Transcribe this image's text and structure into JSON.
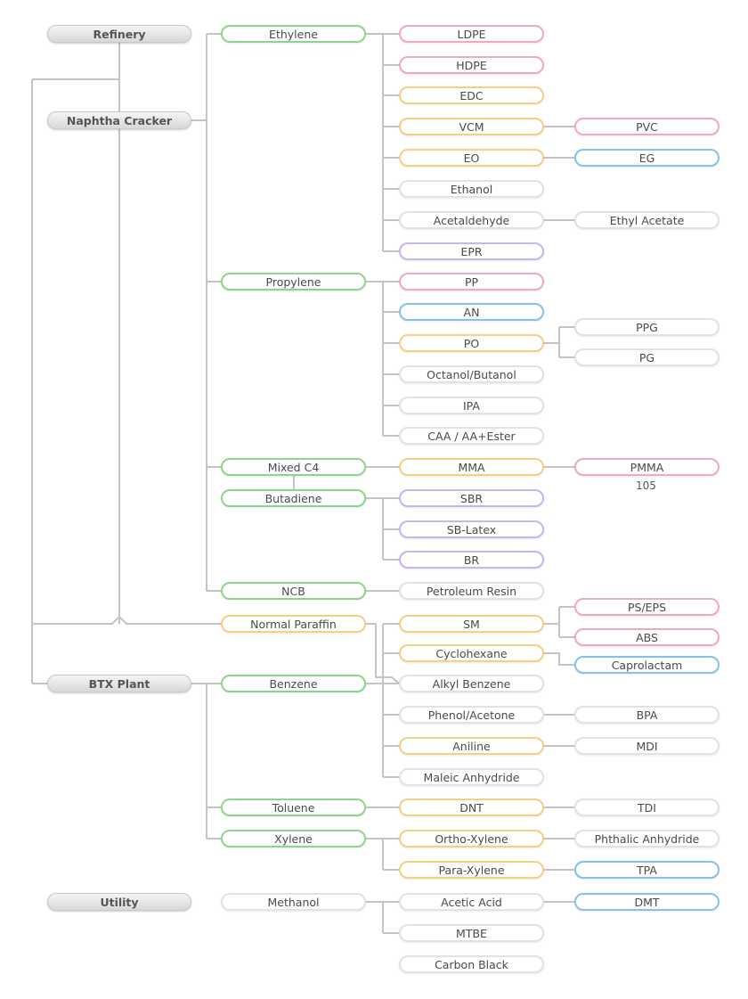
{
  "diagram": {
    "type": "petrochemical product tree",
    "colors": {
      "source": "#d8d8d8",
      "green": "#8fd48a",
      "orange": "#f5cf82",
      "pink": "#f2a9bf",
      "blue": "#86c2e6",
      "purple": "#c9b4ee",
      "gray": "#e2e2e2",
      "connector": "#c4c4c4"
    },
    "sources": {
      "refinery": "Refinery",
      "naphtha_cracker": "Naphtha Cracker",
      "btx_plant": "BTX Plant",
      "utility": "Utility"
    },
    "basics": {
      "ethylene": "Ethylene",
      "propylene": "Propylene",
      "mixed_c4": "Mixed C4",
      "butadiene": "Butadiene",
      "ncb": "NCB",
      "normal_paraffin": "Normal Paraffin",
      "benzene": "Benzene",
      "toluene": "Toluene",
      "xylene": "Xylene",
      "methanol": "Methanol"
    },
    "intermediates": {
      "ldpe": "LDPE",
      "hdpe": "HDPE",
      "edc": "EDC",
      "vcm": "VCM",
      "eo": "EO",
      "ethanol": "Ethanol",
      "acetaldehyde": "Acetaldehyde",
      "epr": "EPR",
      "pp": "PP",
      "an": "AN",
      "po": "PO",
      "octanol_butanol": "Octanol/Butanol",
      "ipa": "IPA",
      "caa": "CAA  / AA+Ester",
      "mma": "MMA",
      "sbr": "SBR",
      "sb_latex": "SB-Latex",
      "br": "BR",
      "petroleum_resin": "Petroleum Resin",
      "sm": "SM",
      "cyclohexane": "Cyclohexane",
      "alkyl_benzene": "Alkyl Benzene",
      "phenol_acetone": "Phenol/Acetone",
      "aniline": "Aniline",
      "maleic_anhydride": "Maleic Anhydride",
      "dnt": "DNT",
      "ortho_xylene": "Ortho-Xylene",
      "para_xylene": "Para-Xylene",
      "acetic_acid": "Acetic Acid",
      "mtbe": "MTBE",
      "carbon_black": "Carbon Black"
    },
    "derivatives": {
      "pvc": "PVC",
      "eg": "EG",
      "ethyl_acetate": "Ethyl Acetate",
      "ppg": "PPG",
      "pg": "PG",
      "pmma": "PMMA",
      "pmma_note": "105",
      "ps_eps": "PS/EPS",
      "abs": "ABS",
      "caprolactam": "Caprolactam",
      "bpa": "BPA",
      "mdi": "MDI",
      "tdi": "TDI",
      "phthalic_anhydride": "Phthalic Anhydride",
      "tpa": "TPA",
      "dmt": "DMT"
    }
  }
}
